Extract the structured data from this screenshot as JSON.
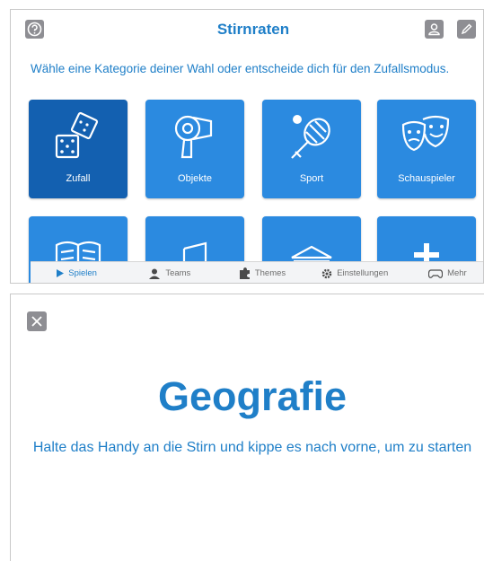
{
  "screen1": {
    "title": "Stirnraten",
    "subtitle": "Wähle eine Kategorie deiner Wahl oder entscheide dich für den Zufallsmodus.",
    "icons": [
      "help-icon",
      "profile-icon",
      "edit-icon"
    ],
    "tiles": [
      {
        "label": "Zufall",
        "icon": "dice-icon",
        "selected": true
      },
      {
        "label": "Objekte",
        "icon": "hairdryer-icon"
      },
      {
        "label": "Sport",
        "icon": "tennis-racket-icon"
      },
      {
        "label": "Schauspieler",
        "icon": "theater-masks-icon"
      },
      {
        "label": "",
        "icon": "book-icon"
      },
      {
        "label": "",
        "icon": "music-icon"
      },
      {
        "label": "",
        "icon": "museum-icon"
      },
      {
        "label": "",
        "icon": "cross-icon"
      }
    ],
    "tabs": [
      {
        "label": "Spielen",
        "icon": "play-icon",
        "active": true
      },
      {
        "label": "Teams",
        "icon": "person-icon"
      },
      {
        "label": "Themes",
        "icon": "puzzle-icon"
      },
      {
        "label": "Einstellungen",
        "icon": "gear-icon"
      },
      {
        "label": "Mehr",
        "icon": "gamepad-icon"
      }
    ],
    "colors": {
      "accent": "#1f7fc8",
      "tile": "#2b8ae0",
      "tile_selected": "#1360b0",
      "icon_gray": "#8e8e93"
    }
  },
  "screen2": {
    "category": "Geografie",
    "instruction": "Halte das Handy an die Stirn und kippe es nach vorne, um zu starten",
    "close_icon": "close-icon"
  }
}
